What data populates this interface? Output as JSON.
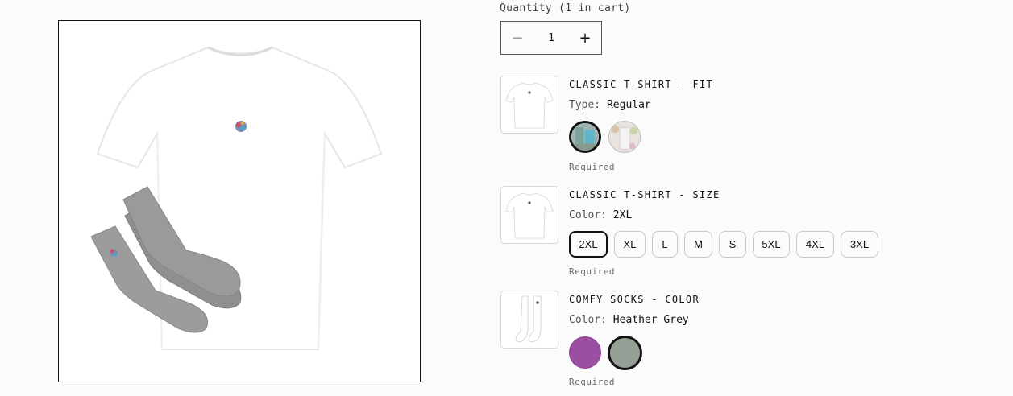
{
  "product": {
    "image_alt": "White t-shirt with embroidered logo and grey socks"
  },
  "quantity": {
    "label": "Quantity (1 in cart)",
    "value": "1",
    "minus_symbol": "−",
    "plus_symbol": "+"
  },
  "options": [
    {
      "title": "CLASSIC T-SHIRT - FIT",
      "value_key": "Type:",
      "value": "Regular",
      "swatches": [
        {
          "name": "Regular",
          "selected": true
        },
        {
          "name": "Relaxed",
          "selected": false
        }
      ],
      "required": "Required"
    },
    {
      "title": "CLASSIC T-SHIRT - SIZE",
      "value_key": "Color:",
      "value": "2XL",
      "sizes": [
        "2XL",
        "XL",
        "L",
        "M",
        "S",
        "5XL",
        "4XL",
        "3XL"
      ],
      "selected_size": "2XL",
      "required": "Required"
    },
    {
      "title": "COMFY SOCKS - COLOR",
      "value_key": "Color:",
      "value": "Heather Grey",
      "swatches": [
        {
          "name": "Purple",
          "color": "#9b4fa3",
          "selected": false
        },
        {
          "name": "Heather Grey",
          "color": "#96a096",
          "selected": true
        }
      ],
      "required": "Required"
    }
  ],
  "colors": {
    "accent": "#121212",
    "background": "#fbfbfb",
    "purple_swatch": "#9b4fa3",
    "grey_swatch": "#96a096"
  }
}
